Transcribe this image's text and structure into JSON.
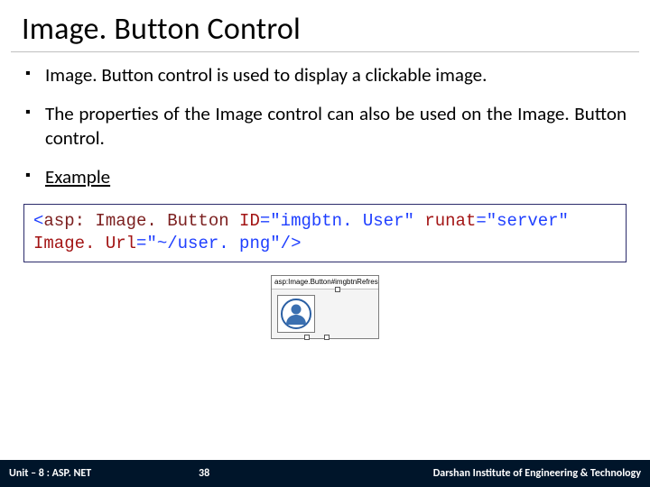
{
  "title": "Image. Button Control",
  "bullets": {
    "b1": "Image. Button control is used to display a clickable image.",
    "b2": "The properties of the Image control can also be used on the Image. Button control.",
    "b3": "Example"
  },
  "code": {
    "open_ang": "<",
    "tag": "asp: Image. Button",
    "attr_id": "ID",
    "val_id": "\"imgbtn. User\"",
    "attr_runat": "runat",
    "val_runat": "\"server\"",
    "attr_src": "Image. Url",
    "val_src": "\"~/user. png\"",
    "eq": "=",
    "close": "/>"
  },
  "designer": {
    "caption": "asp:Image.Button#imgbtnRefresh"
  },
  "footer": {
    "unit": "Unit – 8 : ASP. NET",
    "page": "38",
    "institute": "Darshan Institute of Engineering & Technology"
  }
}
